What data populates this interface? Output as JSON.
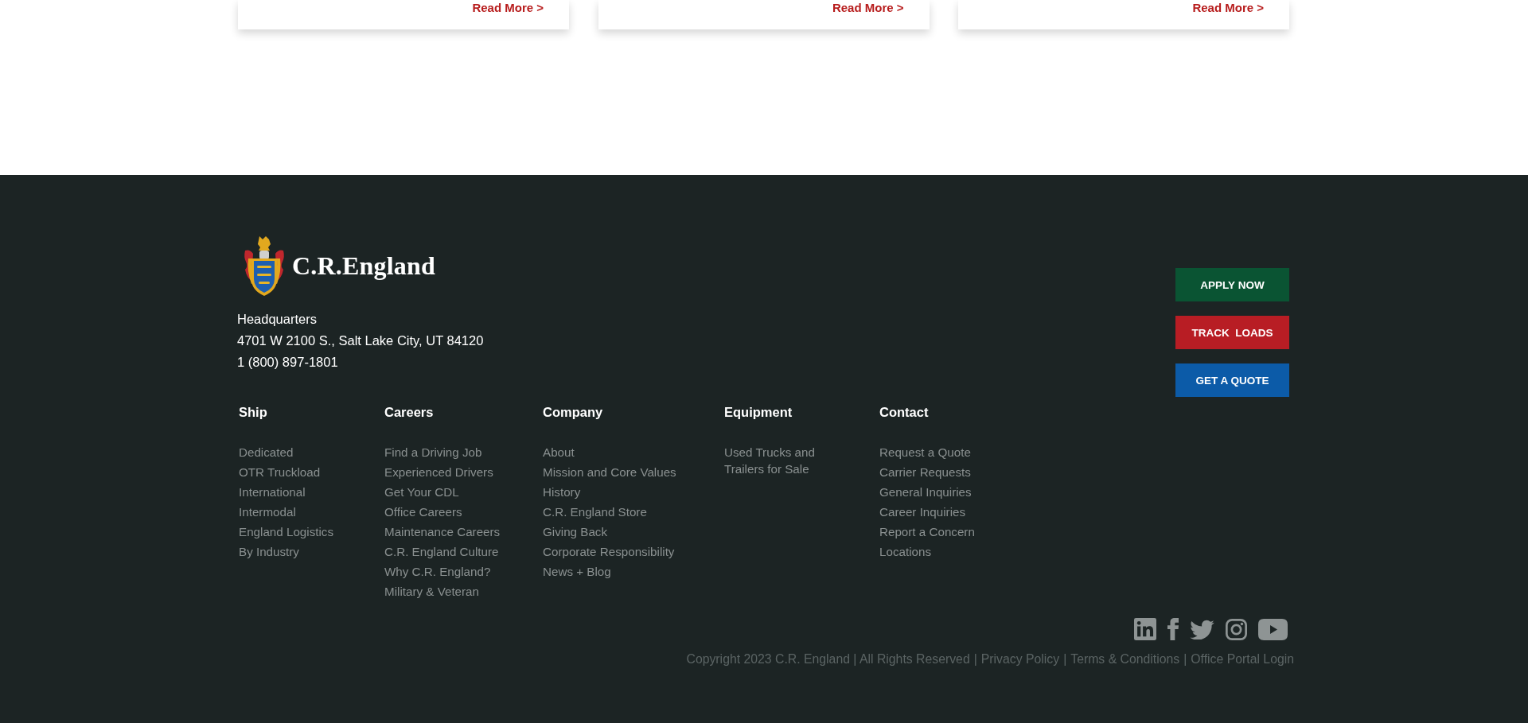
{
  "cards": [
    {
      "link": "Read More >"
    },
    {
      "link": "Read More >"
    },
    {
      "link": "Read More >"
    }
  ],
  "footer": {
    "logo": {
      "text": "C.R.England"
    },
    "address": [
      "Headquarters",
      "4701 W 2100 S., Salt Lake City, UT 84120",
      "1 (800) 897-1801"
    ],
    "buttons": [
      {
        "label": "APPLY NOW",
        "color": "#0a5433"
      },
      {
        "label": "TRACK  LOADS",
        "color": "#b81d24"
      },
      {
        "label": "GET A QUOTE",
        "color": "#0c5ba8"
      }
    ],
    "columns": [
      {
        "heading": "Ship",
        "links": [
          "Dedicated",
          "OTR Truckload",
          "International",
          "Intermodal",
          "England Logistics",
          "By Industry"
        ]
      },
      {
        "heading": "Careers",
        "links": [
          "Find a Driving Job",
          "Experienced Drivers",
          "Get Your CDL",
          "Office Careers",
          "Maintenance Careers",
          "C.R. England Culture",
          "Why C.R. England?",
          "Military & Veteran"
        ]
      },
      {
        "heading": "Company",
        "links": [
          "About",
          "Mission and Core Values",
          "History",
          "C.R. England Store",
          "Giving Back",
          "Corporate Responsibility",
          "News + Blog"
        ]
      },
      {
        "heading": "Equipment",
        "links": [
          "Used Trucks and Trailers for Sale"
        ]
      },
      {
        "heading": "Contact",
        "links": [
          "Request a Quote",
          "Carrier Requests",
          "General Inquiries",
          "Career Inquiries",
          "Report a Concern",
          "Locations"
        ]
      }
    ],
    "legal": {
      "copyright": "Copyright 2023 C.R. England | All Rights Reserved",
      "separator": "|",
      "links": [
        "Privacy Policy",
        "Terms & Conditions",
        "Office Portal Login"
      ]
    }
  }
}
